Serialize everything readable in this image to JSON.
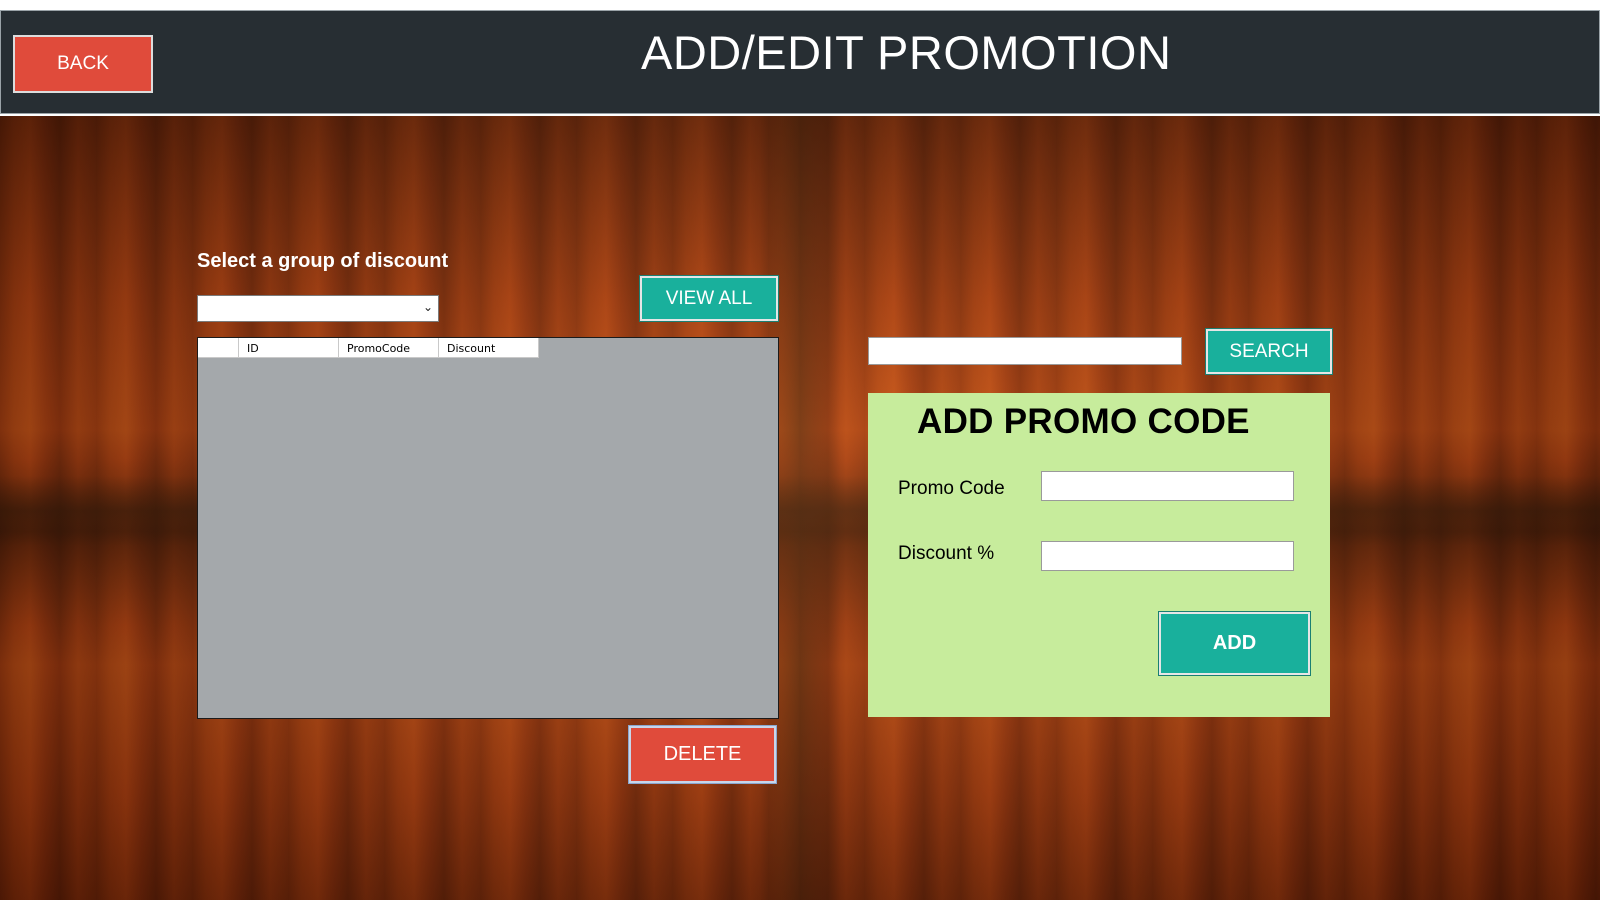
{
  "header": {
    "title": "ADD/EDIT PROMOTION",
    "back_label": "BACK"
  },
  "left": {
    "group_label": "Select a group of discount",
    "group_select_value": "",
    "view_all_label": "VIEW ALL",
    "delete_label": "DELETE",
    "grid": {
      "columns": [
        "ID",
        "PromoCode",
        "Discount"
      ],
      "rows": []
    }
  },
  "right": {
    "search_value": "",
    "search_label": "SEARCH",
    "panel_title": "ADD PROMO CODE",
    "promo_code_label": "Promo Code",
    "promo_code_value": "",
    "discount_label": "Discount %",
    "discount_value": "",
    "add_label": "ADD"
  },
  "colors": {
    "header_bg": "#272e33",
    "red_button": "#e04b3b",
    "teal_button": "#19b09c",
    "panel_bg": "#c7ec9c",
    "grid_bg": "#a4a8ab"
  }
}
